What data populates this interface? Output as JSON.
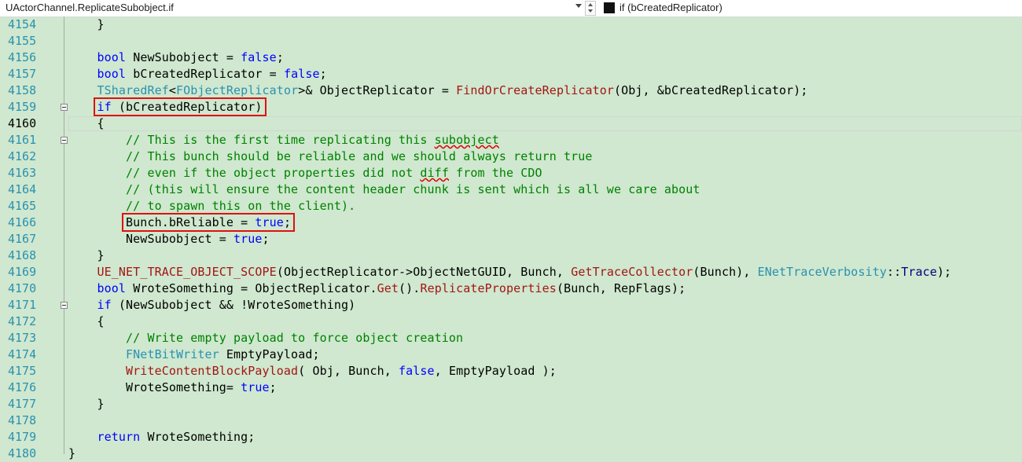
{
  "navbar": {
    "scope": "UActorChannel.ReplicateSubobject.if",
    "member": "if (bCreatedReplicator)"
  },
  "editor": {
    "active_line": "4160",
    "lines": [
      {
        "num": "4154",
        "text": "    }"
      },
      {
        "num": "4155",
        "text": ""
      },
      {
        "num": "4156",
        "text": "    bool NewSubobject = false;"
      },
      {
        "num": "4157",
        "text": "    bool bCreatedReplicator = false;"
      },
      {
        "num": "4158",
        "text": "    TSharedRef<FObjectReplicator>& ObjectReplicator = FindOrCreateReplicator(Obj, &bCreatedReplicator);"
      },
      {
        "num": "4159",
        "text": "    if (bCreatedReplicator)"
      },
      {
        "num": "4160",
        "text": "    {"
      },
      {
        "num": "4161",
        "text": "        // This is the first time replicating this subobject"
      },
      {
        "num": "4162",
        "text": "        // This bunch should be reliable and we should always return true"
      },
      {
        "num": "4163",
        "text": "        // even if the object properties did not diff from the CDO"
      },
      {
        "num": "4164",
        "text": "        // (this will ensure the content header chunk is sent which is all we care about"
      },
      {
        "num": "4165",
        "text": "        // to spawn this on the client)."
      },
      {
        "num": "4166",
        "text": "        Bunch.bReliable = true;"
      },
      {
        "num": "4167",
        "text": "        NewSubobject = true;"
      },
      {
        "num": "4168",
        "text": "    }"
      },
      {
        "num": "4169",
        "text": "    UE_NET_TRACE_OBJECT_SCOPE(ObjectReplicator->ObjectNetGUID, Bunch, GetTraceCollector(Bunch), ENetTraceVerbosity::Trace);"
      },
      {
        "num": "4170",
        "text": "    bool WroteSomething = ObjectReplicator.Get().ReplicateProperties(Bunch, RepFlags);"
      },
      {
        "num": "4171",
        "text": "    if (NewSubobject && !WroteSomething)"
      },
      {
        "num": "4172",
        "text": "    {"
      },
      {
        "num": "4173",
        "text": "        // Write empty payload to force object creation"
      },
      {
        "num": "4174",
        "text": "        FNetBitWriter EmptyPayload;"
      },
      {
        "num": "4175",
        "text": "        WriteContentBlockPayload( Obj, Bunch, false, EmptyPayload );"
      },
      {
        "num": "4176",
        "text": "        WroteSomething= true;"
      },
      {
        "num": "4177",
        "text": "    }"
      },
      {
        "num": "4178",
        "text": ""
      },
      {
        "num": "4179",
        "text": "    return WroteSomething;"
      },
      {
        "num": "4180",
        "text": "}"
      }
    ],
    "highlight_boxes": [
      {
        "line": "4159",
        "label": "if (bCreatedReplicator)"
      },
      {
        "line": "4166",
        "label": "Bunch.bReliable = true;"
      }
    ]
  },
  "colors": {
    "background": "#cfe8cf",
    "keyword": "#0000ff",
    "type": "#2b91af",
    "function": "#a31515",
    "comment": "#008000",
    "line_number": "#2b91af",
    "highlight_box": "#e01010"
  }
}
